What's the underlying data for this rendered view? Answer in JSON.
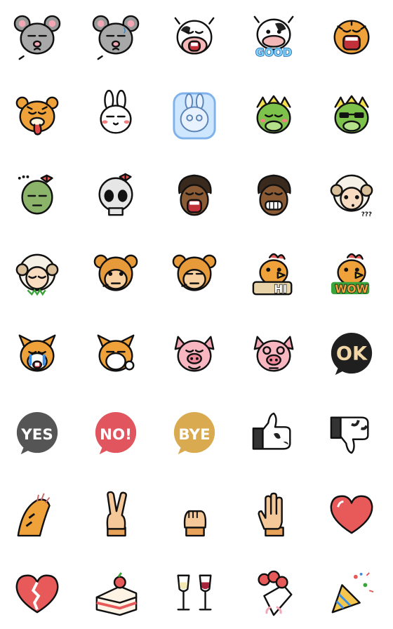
{
  "sheet": {
    "background": "#ffffff",
    "rows": [
      [
        {
          "name": "grey-mouse-sad-icon",
          "kind": "mouse",
          "text": ""
        },
        {
          "name": "grey-mouse-sweat-icon",
          "kind": "mouse2",
          "text": ""
        },
        {
          "name": "cow-shouting-icon",
          "kind": "cowShout",
          "text": ""
        },
        {
          "name": "cow-good-icon",
          "kind": "cowGood",
          "text": "GOOD"
        },
        {
          "name": "tiger-roaring-icon",
          "kind": "tigerRoar",
          "text": ""
        }
      ],
      [
        {
          "name": "tiger-tongue-out-icon",
          "kind": "tigerTongue",
          "text": ""
        },
        {
          "name": "rabbit-blush-icon",
          "kind": "rabbit",
          "text": ""
        },
        {
          "name": "rabbit-blue-glow-icon",
          "kind": "rabbitBlue",
          "text": ""
        },
        {
          "name": "dragon-blush-icon",
          "kind": "dragon",
          "text": ""
        },
        {
          "name": "dragon-sunglasses-icon",
          "kind": "dragonCool",
          "text": ""
        }
      ],
      [
        {
          "name": "zombie-girl-icon",
          "kind": "zombie",
          "text": ""
        },
        {
          "name": "skull-bow-icon",
          "kind": "skull",
          "text": ""
        },
        {
          "name": "horse-shouting-icon",
          "kind": "horseShout",
          "text": ""
        },
        {
          "name": "horse-grinning-icon",
          "kind": "horseGrin",
          "text": ""
        },
        {
          "name": "sheep-confused-icon",
          "kind": "sheepQ",
          "text": "???"
        }
      ],
      [
        {
          "name": "sheep-eating-grass-icon",
          "kind": "sheepGrass",
          "text": ""
        },
        {
          "name": "monkey-smiling-icon",
          "kind": "monkey",
          "text": ""
        },
        {
          "name": "monkey-bored-icon",
          "kind": "monkey2",
          "text": ""
        },
        {
          "name": "rooster-hi-icon",
          "kind": "roosterHi",
          "text": "HI"
        },
        {
          "name": "rooster-wow-icon",
          "kind": "roosterWow",
          "text": "WOW"
        }
      ],
      [
        {
          "name": "dog-crying-icon",
          "kind": "dogCry",
          "text": ""
        },
        {
          "name": "dog-sleepy-icon",
          "kind": "dogSleepy",
          "text": ""
        },
        {
          "name": "pig-drooling-icon",
          "kind": "pigDrool",
          "text": ""
        },
        {
          "name": "pig-dizzy-icon",
          "kind": "pigDizzy",
          "text": ""
        },
        {
          "name": "ok-bubble-icon",
          "kind": "bubble",
          "text": "OK",
          "color": "#1f1f1f",
          "textColor": "#f2d7a6"
        }
      ],
      [
        {
          "name": "yes-bubble-icon",
          "kind": "bubble",
          "text": "YES",
          "color": "#555555",
          "textColor": "#ffffff"
        },
        {
          "name": "no-bubble-icon",
          "kind": "bubble",
          "text": "NO!",
          "color": "#e0555e",
          "textColor": "#ffffff"
        },
        {
          "name": "bye-bubble-icon",
          "kind": "bubble",
          "text": "BYE",
          "color": "#d9aa4f",
          "textColor": "#ffffff"
        },
        {
          "name": "cow-thumbs-up-icon",
          "kind": "thumbUp",
          "text": ""
        },
        {
          "name": "cow-thumbs-down-icon",
          "kind": "thumbDown",
          "text": ""
        }
      ],
      [
        {
          "name": "tiger-paw-scratch-icon",
          "kind": "paw",
          "text": ""
        },
        {
          "name": "peace-hand-icon",
          "kind": "peace",
          "text": ""
        },
        {
          "name": "fist-hand-icon",
          "kind": "fist",
          "text": ""
        },
        {
          "name": "open-hand-icon",
          "kind": "openHand",
          "text": ""
        },
        {
          "name": "red-heart-icon",
          "kind": "heart",
          "text": ""
        }
      ],
      [
        {
          "name": "broken-heart-icon",
          "kind": "brokenHeart",
          "text": ""
        },
        {
          "name": "strawberry-cake-icon",
          "kind": "cake",
          "text": ""
        },
        {
          "name": "wine-toast-icon",
          "kind": "wine",
          "text": ""
        },
        {
          "name": "rose-bouquet-icon",
          "kind": "bouquet",
          "text": ""
        },
        {
          "name": "party-popper-icon",
          "kind": "popper",
          "text": ""
        }
      ]
    ]
  }
}
